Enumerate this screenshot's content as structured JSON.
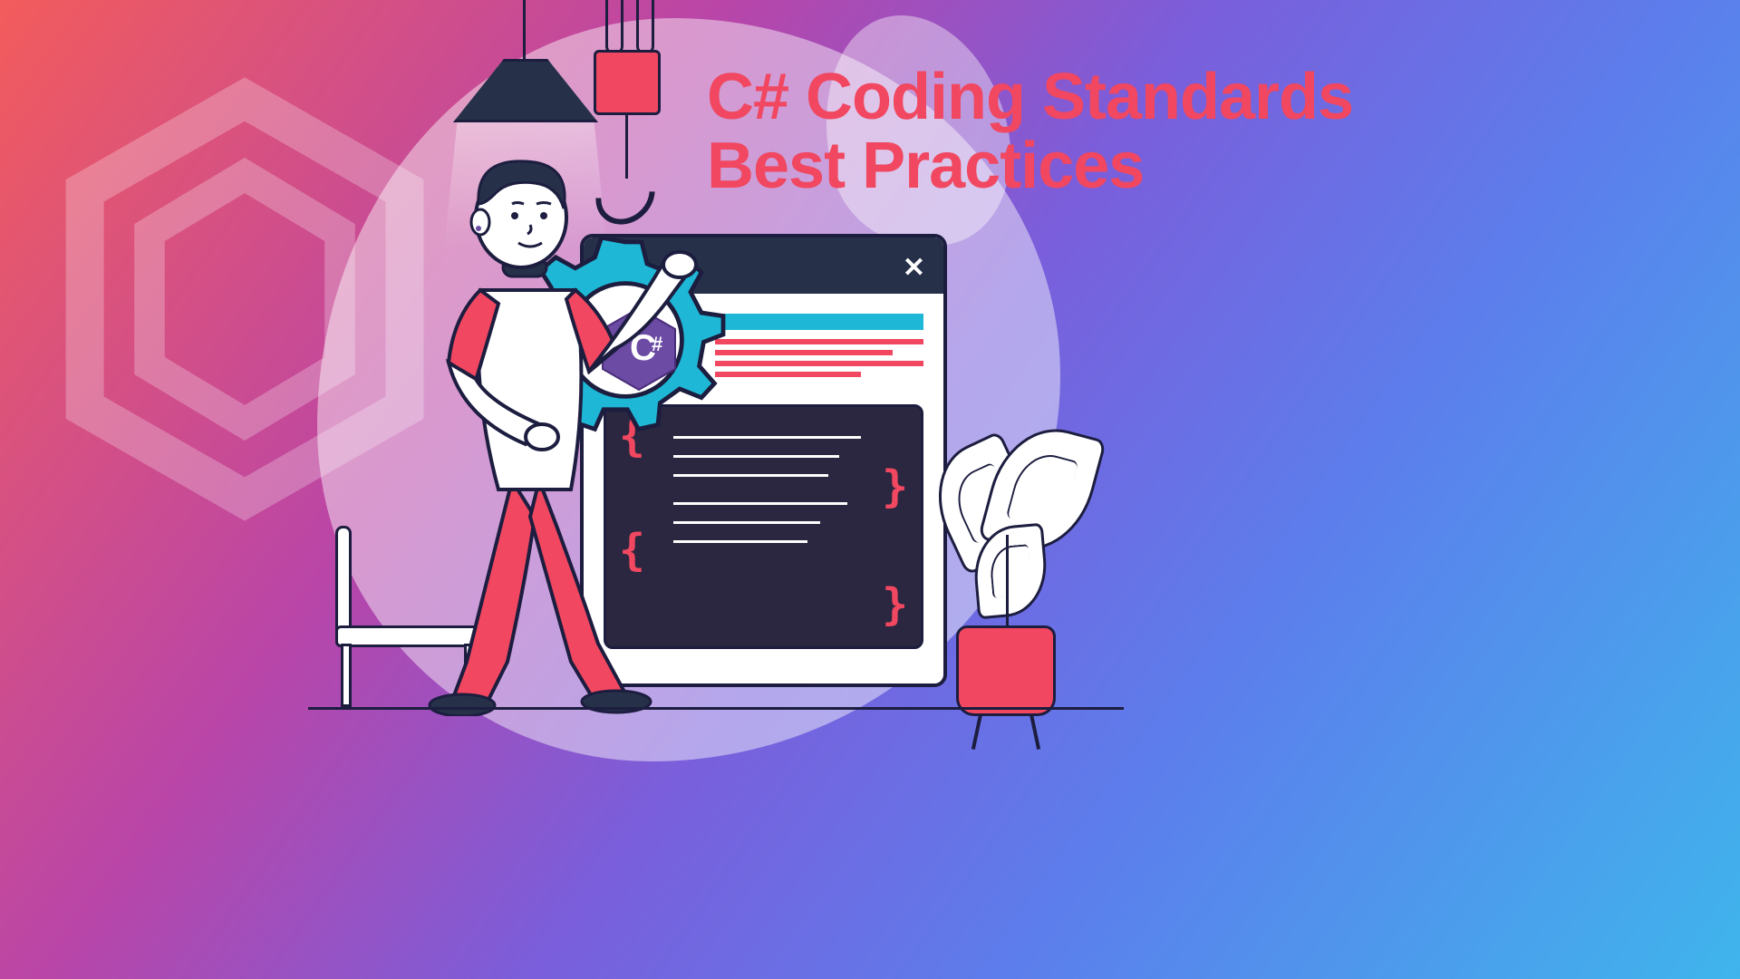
{
  "title_line1": "C# Coding Standards",
  "title_line2": "Best Practices",
  "logo_text": "C#",
  "window": {
    "close_symbol": "✕",
    "braces": {
      "open": "{",
      "close": "}"
    }
  },
  "colors": {
    "accent_red": "#f14760",
    "accent_cyan": "#1fb7d6",
    "dark_navy": "#263149",
    "code_bg": "#2b2740"
  }
}
